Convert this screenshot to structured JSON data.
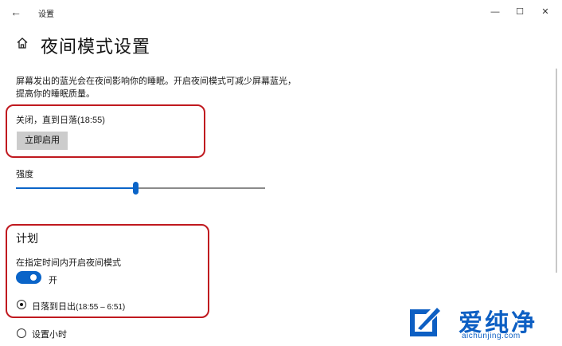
{
  "window": {
    "title": "设置",
    "back_glyph": "←",
    "minimize_glyph": "—",
    "maximize_glyph": "☐",
    "close_glyph": "✕"
  },
  "header": {
    "title": "夜间模式设置",
    "home_icon": "home-icon"
  },
  "night_light": {
    "description": "屏幕发出的蓝光会在夜间影响你的睡眠。开启夜间模式可减少屏幕蓝光，提高你的睡眠质量。",
    "status": "关闭，直到日落(18:55)",
    "enable_button": "立即启用"
  },
  "strength": {
    "label": "强度",
    "value_fraction": 0.48
  },
  "schedule": {
    "heading": "计划",
    "toggle_label": "在指定时间内开启夜间模式",
    "toggle_state": "开",
    "toggle_on": true,
    "options": [
      {
        "label": "日落到日出",
        "detail": "(18:55 – 6:51)",
        "selected": true
      },
      {
        "label": "设置小时",
        "selected": false
      }
    ]
  },
  "watermark": {
    "brand": "爱纯净",
    "url": "aichunjing.com",
    "color": "#0d5fc3"
  },
  "colors": {
    "accent": "#0a64c8",
    "highlight_box": "#c0191f",
    "button_bg": "#cccccc"
  }
}
